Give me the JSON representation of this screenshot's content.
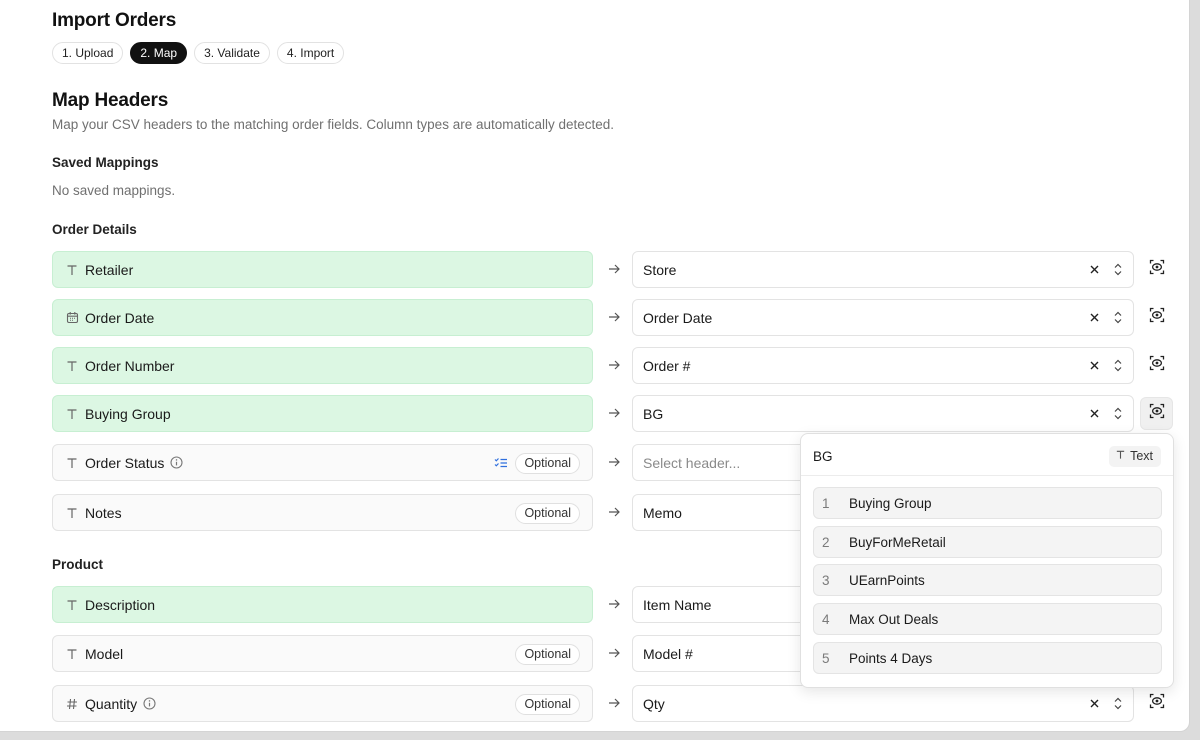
{
  "page": {
    "title": "Import Orders"
  },
  "steps": [
    "1. Upload",
    "2. Map",
    "3. Validate",
    "4. Import"
  ],
  "active_step": "2. Map",
  "section": {
    "title": "Map Headers",
    "description": "Map your CSV headers to the matching order fields. Column types are automatically detected."
  },
  "saved": {
    "label": "Saved Mappings",
    "empty": "No saved mappings."
  },
  "groups": {
    "order_details": "Order Details",
    "product": "Product"
  },
  "optional_label": "Optional",
  "select_placeholder": "Select header...",
  "rows": [
    {
      "field": "Retailer",
      "type_icon": "text-type-icon",
      "mapped": true,
      "value": "Store"
    },
    {
      "field": "Order Date",
      "type_icon": "calendar-icon",
      "mapped": true,
      "value": "Order Date"
    },
    {
      "field": "Order Number",
      "type_icon": "text-type-icon",
      "mapped": true,
      "value": "Order #"
    },
    {
      "field": "Buying Group",
      "type_icon": "text-type-icon",
      "mapped": true,
      "value": "BG"
    },
    {
      "field": "Order Status",
      "type_icon": "text-type-icon",
      "mapped": false,
      "optional": true,
      "info": true,
      "list_icon": true,
      "value": ""
    },
    {
      "field": "Notes",
      "type_icon": "text-type-icon",
      "mapped": false,
      "optional": true,
      "value": "Memo"
    },
    {
      "field": "Description",
      "type_icon": "text-type-icon",
      "mapped": true,
      "value": "Item Name"
    },
    {
      "field": "Model",
      "type_icon": "text-type-icon",
      "mapped": false,
      "optional": true,
      "value": "Model #"
    },
    {
      "field": "Quantity",
      "type_icon": "hash-icon",
      "mapped": false,
      "optional": true,
      "info": true,
      "value": "Qty"
    }
  ],
  "preview": {
    "header": "BG",
    "type": "Text",
    "samples": [
      {
        "index": "1",
        "value": "Buying Group"
      },
      {
        "index": "2",
        "value": "BuyForMeRetail"
      },
      {
        "index": "3",
        "value": "UEarnPoints"
      },
      {
        "index": "4",
        "value": "Max Out Deals"
      },
      {
        "index": "5",
        "value": "Points 4 Days"
      }
    ]
  },
  "colors": {
    "mapped_bg": "#dcf7e3",
    "accent_blue": "#2f6fde"
  }
}
